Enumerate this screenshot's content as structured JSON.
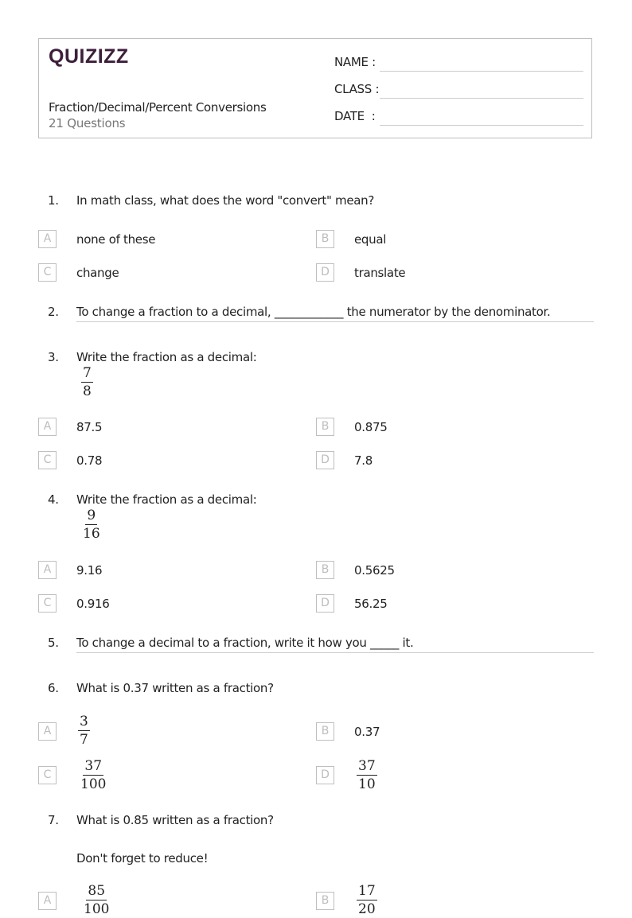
{
  "header": {
    "logo": "QUIZIZZ",
    "title": "Fraction/Decimal/Percent Conversions",
    "subtitle": "21 Questions",
    "fields": [
      {
        "label": "NAME :"
      },
      {
        "label": "CLASS :"
      },
      {
        "label": "DATE  :"
      }
    ]
  },
  "questions": [
    {
      "number": "1.",
      "text": "In math class, what does the word \"convert\" mean?",
      "options": [
        {
          "letter": "A",
          "text": "none of these"
        },
        {
          "letter": "B",
          "text": "equal"
        },
        {
          "letter": "C",
          "text": "change"
        },
        {
          "letter": "D",
          "text": "translate"
        }
      ]
    },
    {
      "number": "2.",
      "text": "To change a fraction to a decimal, ____________ the numerator by the denominator."
    },
    {
      "number": "3.",
      "text": "Write the fraction as a decimal:",
      "fraction": {
        "num": "7",
        "den": "8"
      },
      "options": [
        {
          "letter": "A",
          "text": "87.5"
        },
        {
          "letter": "B",
          "text": "0.875"
        },
        {
          "letter": "C",
          "text": "0.78"
        },
        {
          "letter": "D",
          "text": "7.8"
        }
      ]
    },
    {
      "number": "4.",
      "text": "Write the fraction as a decimal:",
      "fraction": {
        "num": "9",
        "den": "16"
      },
      "options": [
        {
          "letter": "A",
          "text": "9.16"
        },
        {
          "letter": "B",
          "text": "0.5625"
        },
        {
          "letter": "C",
          "text": "0.916"
        },
        {
          "letter": "D",
          "text": "56.25"
        }
      ]
    },
    {
      "number": "5.",
      "text": "To change a decimal to a fraction, write it how you _____ it."
    },
    {
      "number": "6.",
      "text": "What is 0.37 written as a fraction?",
      "options": [
        {
          "letter": "A",
          "num": "3",
          "den": "7"
        },
        {
          "letter": "B",
          "text": "0.37"
        },
        {
          "letter": "C",
          "num": "37",
          "den": "100"
        },
        {
          "letter": "D",
          "num": "37",
          "den": "10"
        }
      ]
    },
    {
      "number": "7.",
      "text": "What is 0.85 written as a fraction?",
      "note": "Don't forget to reduce!",
      "options": [
        {
          "letter": "A",
          "num": "85",
          "den": "100"
        },
        {
          "letter": "B",
          "num": "17",
          "den": "20"
        }
      ]
    }
  ]
}
